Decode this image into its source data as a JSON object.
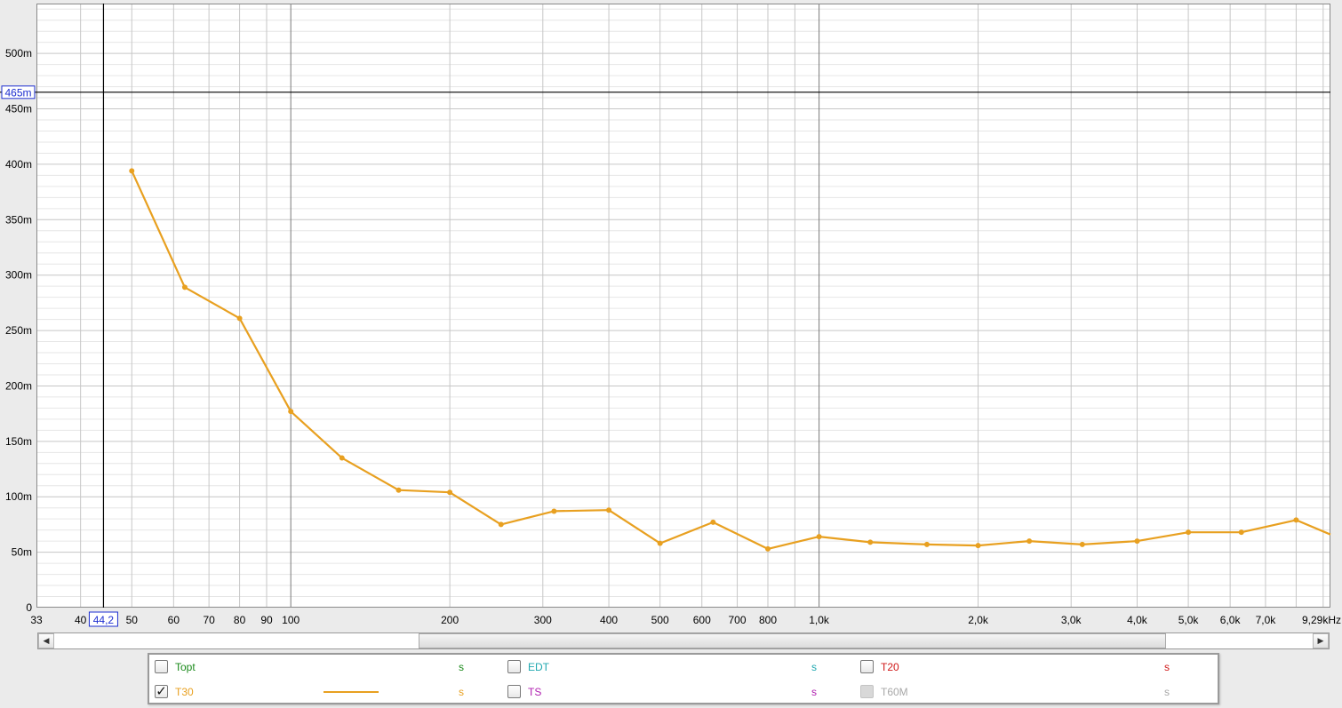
{
  "chart_data": {
    "type": "line",
    "xscale": "log",
    "xlim": [
      33,
      9290
    ],
    "ylim": [
      0,
      545
    ],
    "y_ticks": [
      {
        "value": 0,
        "label": "0"
      },
      {
        "value": 50,
        "label": "50m"
      },
      {
        "value": 100,
        "label": "100m"
      },
      {
        "value": 150,
        "label": "150m"
      },
      {
        "value": 200,
        "label": "200m"
      },
      {
        "value": 250,
        "label": "250m"
      },
      {
        "value": 300,
        "label": "300m"
      },
      {
        "value": 350,
        "label": "350m"
      },
      {
        "value": 400,
        "label": "400m"
      },
      {
        "value": 450,
        "label": "450m"
      },
      {
        "value": 500,
        "label": "500m"
      }
    ],
    "x_ticks": [
      {
        "value": 33,
        "label": "33"
      },
      {
        "value": 40,
        "label": "40"
      },
      {
        "value": 50,
        "label": "50"
      },
      {
        "value": 60,
        "label": "60"
      },
      {
        "value": 70,
        "label": "70"
      },
      {
        "value": 80,
        "label": "80"
      },
      {
        "value": 90,
        "label": "90"
      },
      {
        "value": 100,
        "label": "100"
      },
      {
        "value": 200,
        "label": "200"
      },
      {
        "value": 300,
        "label": "300"
      },
      {
        "value": 400,
        "label": "400"
      },
      {
        "value": 500,
        "label": "500"
      },
      {
        "value": 600,
        "label": "600"
      },
      {
        "value": 700,
        "label": "700"
      },
      {
        "value": 800,
        "label": "800"
      },
      {
        "value": 1000,
        "label": "1,0k"
      },
      {
        "value": 2000,
        "label": "2,0k"
      },
      {
        "value": 3000,
        "label": "3,0k"
      },
      {
        "value": 4000,
        "label": "4,0k"
      },
      {
        "value": 5000,
        "label": "5,0k"
      },
      {
        "value": 6000,
        "label": "6,0k"
      },
      {
        "value": 7000,
        "label": "7,0k"
      },
      {
        "value": 9290,
        "label": "9,29kHz"
      }
    ],
    "cursor": {
      "x": 44.2,
      "x_label": "44,2",
      "y": 465,
      "y_label": "465m"
    },
    "grid": true,
    "series": [
      {
        "name": "T30",
        "color": "#e8a020",
        "x": [
          50,
          63,
          80,
          100,
          125,
          160,
          200,
          250,
          315,
          400,
          500,
          630,
          800,
          1000,
          1250,
          1600,
          2000,
          2500,
          3150,
          4000,
          5000,
          6300,
          8000,
          9290
        ],
        "y": [
          394,
          289,
          261,
          177,
          135,
          106,
          104,
          75,
          87,
          88,
          58,
          77,
          53,
          64,
          59,
          57,
          56,
          60,
          57,
          60,
          68,
          68,
          79,
          66
        ],
        "markers": [
          true,
          true,
          true,
          true,
          true,
          true,
          true,
          true,
          true,
          true,
          true,
          true,
          true,
          true,
          true,
          true,
          true,
          true,
          true,
          true,
          true,
          true,
          true,
          false
        ]
      }
    ]
  },
  "legend": {
    "items": [
      {
        "id": "topt",
        "label": "Topt",
        "unit": "s",
        "color": "#1a8a1a",
        "checked": false,
        "disabled": false,
        "line": false
      },
      {
        "id": "edt",
        "label": "EDT",
        "unit": "s",
        "color": "#20a8b0",
        "checked": false,
        "disabled": false,
        "line": false
      },
      {
        "id": "t20",
        "label": "T20",
        "unit": "s",
        "color": "#d01818",
        "checked": false,
        "disabled": false,
        "line": false
      },
      {
        "id": "t30",
        "label": "T30",
        "unit": "s",
        "color": "#e8a020",
        "checked": true,
        "disabled": false,
        "line": true
      },
      {
        "id": "ts",
        "label": "TS",
        "unit": "s",
        "color": "#b020b0",
        "checked": false,
        "disabled": false,
        "line": false
      },
      {
        "id": "t60m",
        "label": "T60M",
        "unit": "s",
        "color": "#a8a8a8",
        "checked": false,
        "disabled": true,
        "line": false
      }
    ]
  },
  "scrollbar": {
    "left_arrow": "◀",
    "right_arrow": "▶"
  }
}
